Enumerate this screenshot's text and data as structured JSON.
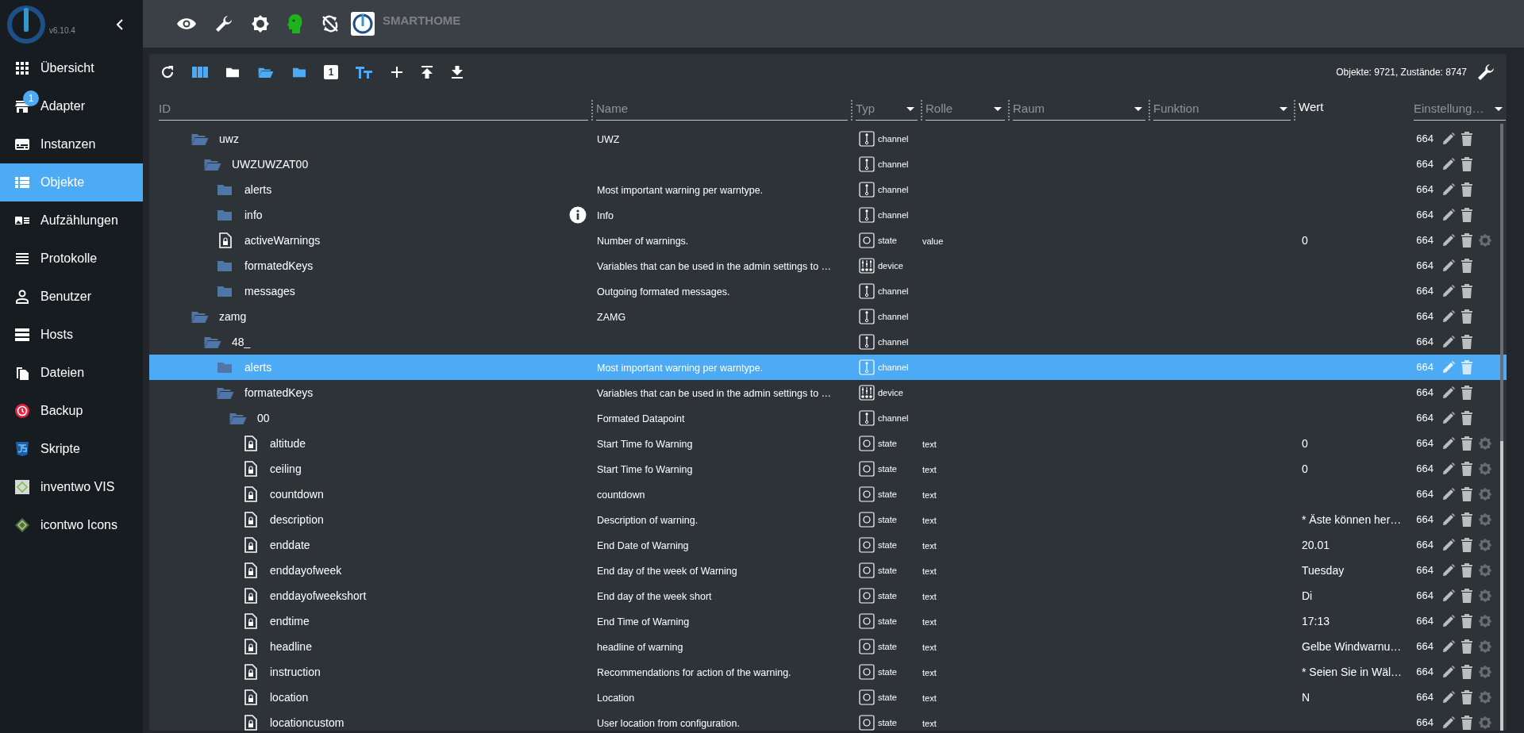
{
  "app": {
    "version": "v6.10.4",
    "title": "SMARTHOME"
  },
  "sidebar": {
    "items": [
      {
        "label": "Übersicht",
        "selected": false
      },
      {
        "label": "Adapter",
        "selected": false,
        "badge": "1"
      },
      {
        "label": "Instanzen",
        "selected": false
      },
      {
        "label": "Objekte",
        "selected": true
      },
      {
        "label": "Aufzählungen",
        "selected": false
      },
      {
        "label": "Protokolle",
        "selected": false
      },
      {
        "label": "Benutzer",
        "selected": false
      },
      {
        "label": "Hosts",
        "selected": false
      },
      {
        "label": "Dateien",
        "selected": false
      },
      {
        "label": "Backup",
        "selected": false
      },
      {
        "label": "Skripte",
        "selected": false
      },
      {
        "label": "inventwo VIS",
        "selected": false
      },
      {
        "label": "icontwo Icons",
        "selected": false
      }
    ]
  },
  "toolbar": {
    "page_badge": "1",
    "stats": "Objekte: 9721, Zustände: 8747"
  },
  "table": {
    "columns": [
      {
        "label": "ID",
        "kind": "input"
      },
      {
        "label": "Name",
        "kind": "input"
      },
      {
        "label": "Typ",
        "kind": "select"
      },
      {
        "label": "Rolle",
        "kind": "select"
      },
      {
        "label": "Raum",
        "kind": "select"
      },
      {
        "label": "Funktion",
        "kind": "select"
      },
      {
        "label": "Wert",
        "kind": "plain"
      },
      {
        "label": "Einstellung…",
        "kind": "select"
      }
    ],
    "rows": [
      {
        "id": "uwz",
        "name": "UWZ",
        "type": "channel",
        "acl": "664",
        "expanded": true,
        "selected": false,
        "hovered": false,
        "children": [
          {
            "id": "UWZUWZAT00",
            "type": "channel",
            "acl": "664",
            "expanded": true,
            "selected": false,
            "hovered": false,
            "children": [
              {
                "id": "alerts",
                "name": "Most important warning per warntype.",
                "type": "channel",
                "acl": "664",
                "expanded": false,
                "selected": false,
                "hovered": false
              },
              {
                "id": "info",
                "name": "Info",
                "type": "channel",
                "acl": "664",
                "expanded": false,
                "selected": false,
                "hovered": true
              },
              {
                "id": "activeWarnings",
                "name": "Number of warnings.",
                "type": "state",
                "role": "value",
                "value": "0",
                "acl": "664",
                "selected": false,
                "hovered": false
              },
              {
                "id": "formatedKeys",
                "name": "Variables that can be used in the admin settings to …",
                "type": "device",
                "acl": "664",
                "expanded": false,
                "selected": false,
                "hovered": false
              },
              {
                "id": "messages",
                "name": "Outgoing formated messages.",
                "type": "channel",
                "acl": "664",
                "expanded": false,
                "selected": false,
                "hovered": false
              }
            ]
          }
        ]
      },
      {
        "id": "zamg",
        "name": "ZAMG",
        "type": "channel",
        "acl": "664",
        "expanded": true,
        "selected": false,
        "hovered": false,
        "children": [
          {
            "id": "48_",
            "type": "channel",
            "acl": "664",
            "expanded": true,
            "selected": false,
            "hovered": false,
            "children": [
              {
                "id": "alerts",
                "name": "Most important warning per warntype.",
                "type": "channel",
                "acl": "664",
                "expanded": false,
                "selected": true,
                "hovered": false
              },
              {
                "id": "formatedKeys",
                "name": "Variables that can be used in the admin settings to …",
                "type": "device",
                "acl": "664",
                "expanded": true,
                "selected": false,
                "hovered": false,
                "children": [
                  {
                    "id": "00",
                    "name": "Formated Datapoint",
                    "type": "channel",
                    "acl": "664",
                    "expanded": true,
                    "selected": false,
                    "hovered": false,
                    "children": [
                      {
                        "id": "altitude",
                        "name": "Start Time fo Warning",
                        "type": "state",
                        "role": "text",
                        "value": "0",
                        "acl": "664",
                        "selected": false,
                        "hovered": false
                      },
                      {
                        "id": "ceiling",
                        "name": "Start Time fo Warning",
                        "type": "state",
                        "role": "text",
                        "value": "0",
                        "acl": "664",
                        "selected": false,
                        "hovered": false
                      },
                      {
                        "id": "countdown",
                        "name": "countdown",
                        "type": "state",
                        "role": "text",
                        "acl": "664",
                        "selected": false,
                        "hovered": false
                      },
                      {
                        "id": "description",
                        "name": "Description of warning.",
                        "type": "state",
                        "role": "text",
                        "value": "* Äste können her…",
                        "acl": "664",
                        "selected": false,
                        "hovered": false
                      },
                      {
                        "id": "enddate",
                        "name": "End Date of Warning",
                        "type": "state",
                        "role": "text",
                        "value": "20.01",
                        "acl": "664",
                        "selected": false,
                        "hovered": false
                      },
                      {
                        "id": "enddayofweek",
                        "name": "End day of the week of Warning",
                        "type": "state",
                        "role": "text",
                        "value": "Tuesday",
                        "acl": "664",
                        "selected": false,
                        "hovered": false
                      },
                      {
                        "id": "enddayofweekshort",
                        "name": "End day of the week short",
                        "type": "state",
                        "role": "text",
                        "value": "Di",
                        "acl": "664",
                        "selected": false,
                        "hovered": false
                      },
                      {
                        "id": "endtime",
                        "name": "End Time of Warning",
                        "type": "state",
                        "role": "text",
                        "value": "17:13",
                        "acl": "664",
                        "selected": false,
                        "hovered": false
                      },
                      {
                        "id": "headline",
                        "name": "headline of warning",
                        "type": "state",
                        "role": "text",
                        "value": "Gelbe Windwarnu…",
                        "acl": "664",
                        "selected": false,
                        "hovered": false
                      },
                      {
                        "id": "instruction",
                        "name": "Recommendations for action of the warning.",
                        "type": "state",
                        "role": "text",
                        "value": "* Seien Sie in Wäl…",
                        "acl": "664",
                        "selected": false,
                        "hovered": false
                      },
                      {
                        "id": "location",
                        "name": "Location",
                        "type": "state",
                        "role": "text",
                        "value": "N",
                        "acl": "664",
                        "selected": false,
                        "hovered": false
                      },
                      {
                        "id": "locationcustom",
                        "name": "User location from configuration.",
                        "type": "state",
                        "role": "text",
                        "acl": "664",
                        "selected": false,
                        "hovered": false
                      }
                    ]
                  }
                ]
              }
            ]
          }
        ]
      }
    ]
  }
}
